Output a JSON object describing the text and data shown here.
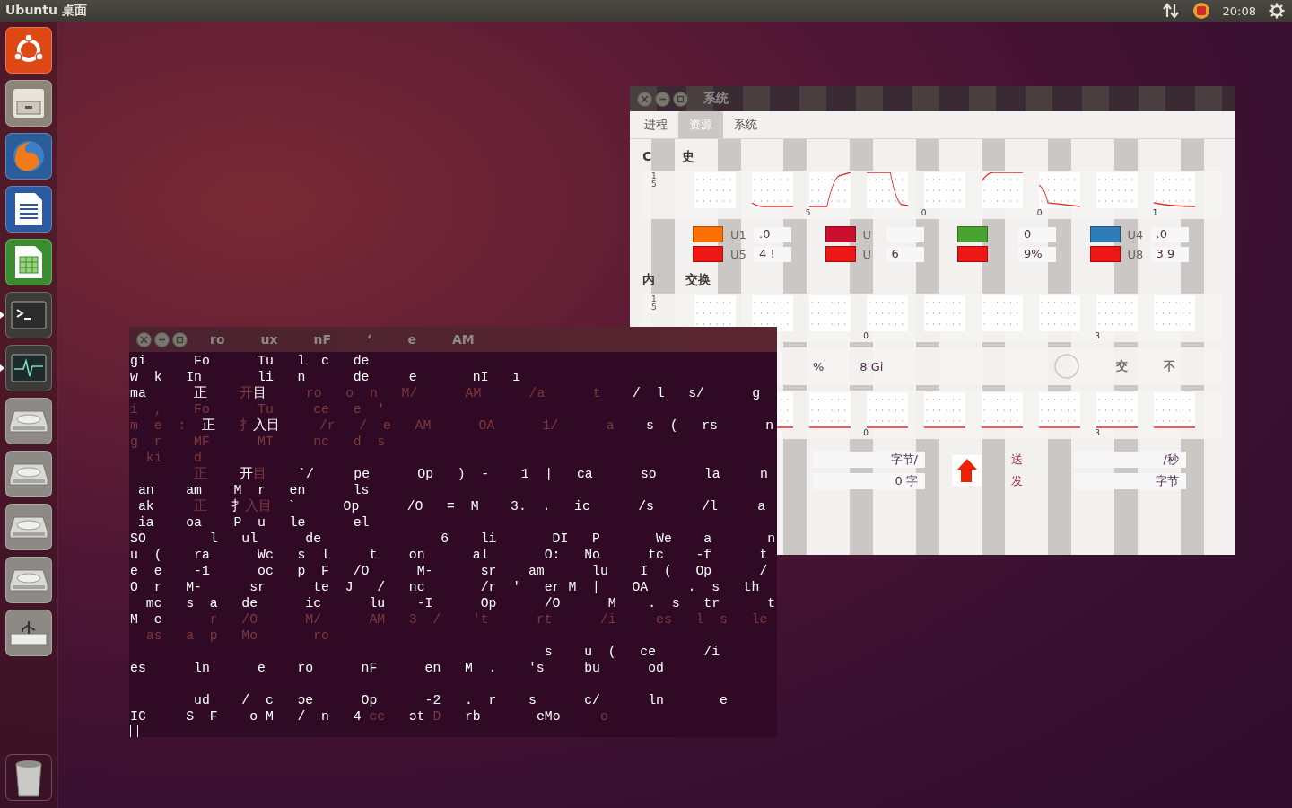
{
  "top_bar": {
    "title": "Ubuntu 桌面",
    "clock": "20:08"
  },
  "launcher": [
    {
      "kind": "ubuntu",
      "running": false
    },
    {
      "kind": "files",
      "running": false
    },
    {
      "kind": "firefox",
      "running": false
    },
    {
      "kind": "writer",
      "running": false
    },
    {
      "kind": "calc",
      "running": false
    },
    {
      "kind": "terminal",
      "running": true
    },
    {
      "kind": "monitor",
      "running": true
    },
    {
      "kind": "drive",
      "running": false
    },
    {
      "kind": "drive",
      "running": false
    },
    {
      "kind": "drive",
      "running": false
    },
    {
      "kind": "drive",
      "running": false
    },
    {
      "kind": "usb",
      "running": false
    },
    {
      "kind": "trash",
      "running": false
    }
  ],
  "system_monitor": {
    "title": "系统",
    "tabs": [
      {
        "label": "进程",
        "selected": false
      },
      {
        "label": "资源",
        "selected": true
      },
      {
        "label": "系统",
        "selected": false
      }
    ],
    "cpu": {
      "heading": [
        "C",
        "史"
      ],
      "y_labels": [
        "1",
        "5"
      ],
      "x_labels": [
        "5",
        "0",
        "0",
        "1"
      ],
      "legend": [
        {
          "color": "#ff7000",
          "label": "U1",
          "value": ".0"
        },
        {
          "color": "#c8102e",
          "label": "U"
        },
        {
          "color": "#4aa232",
          "value": "0"
        },
        {
          "color": "#2e7db8",
          "label": "U4",
          "value": ".0"
        },
        {
          "color": "#ee1515",
          "label": "U5",
          "value": "4 !"
        },
        {
          "color": "#ee1515",
          "label": "U",
          "value": "6"
        },
        {
          "color": "#ee1515",
          "value": "9%"
        },
        {
          "color": "#ee1515",
          "label": "U8",
          "value": "3 9"
        }
      ]
    },
    "memory": {
      "heading": [
        "内",
        "交换"
      ],
      "y_labels": [
        "1",
        "5"
      ],
      "x_labels": [
        "0",
        "3"
      ],
      "percent": "%",
      "amount": "8 Gi",
      "swap": [
        "交",
        "不"
      ]
    },
    "network": {
      "x_labels": [
        "0",
        "3"
      ],
      "receive": [
        "字节/",
        "0 字"
      ],
      "send_label": [
        "送",
        "发"
      ],
      "send": [
        "/秒",
        "字节"
      ]
    }
  },
  "terminal": {
    "title": [
      "ro",
      "ux",
      "nF",
      "ʻ",
      "e",
      "AM"
    ],
    "lines": [
      {
        "segments": [
          {
            "text": "gi      Fo      Tu   l  c   de",
            "dim": false
          }
        ]
      },
      {
        "segments": [
          {
            "text": "w  k   In       li   n      de     e       nI   ı",
            "dim": false
          }
        ]
      },
      {
        "segments": [
          {
            "text": "ma      正",
            "dim": false
          },
          {
            "text": "    开",
            "dim": true
          },
          {
            "text": "目",
            "dim": false
          },
          {
            "text": "     ro   o  n   M/      AM      /a      t",
            "dim": true
          },
          {
            "text": "    /  l   s/      g",
            "dim": false
          }
        ]
      },
      {
        "segments": [
          {
            "text": "i  ,    Fo      Tu     ce   e  '",
            "dim": true
          }
        ]
      },
      {
        "segments": [
          {
            "text": "m  e  :  ",
            "dim": true
          },
          {
            "text": "正",
            "dim": false
          },
          {
            "text": "   扌",
            "dim": true
          },
          {
            "text": "入目",
            "dim": false
          },
          {
            "text": "     /r   /  e   AM      OA      1/      a",
            "dim": true
          },
          {
            "text": "    s  (   rs      n",
            "dim": false
          }
        ]
      },
      {
        "segments": [
          {
            "text": "g  r    MF      MT     nc   d  s",
            "dim": true
          }
        ]
      },
      {
        "segments": [
          {
            "text": "  ki    d",
            "dim": true
          }
        ]
      },
      {
        "segments": [
          {
            "text": "        正",
            "dim": true
          },
          {
            "text": "    开",
            "dim": false
          },
          {
            "text": "目",
            "dim": true
          },
          {
            "text": "    `/     pe      Op   )  -    1  |   ca      so      la     n",
            "dim": false
          }
        ]
      },
      {
        "segments": [
          {
            "text": " an    am    M  r   en      ls",
            "dim": false
          }
        ]
      },
      {
        "segments": [
          {
            "text": " ak",
            "dim": false
          },
          {
            "text": "     正",
            "dim": true
          },
          {
            "text": "   扌",
            "dim": false
          },
          {
            "text": "入目",
            "dim": true
          },
          {
            "text": "  `      Op      /O   =  M    3.  .   ic      /s      /l     a",
            "dim": false
          }
        ]
      },
      {
        "segments": [
          {
            "text": " ia    oa    P  u   le      el",
            "dim": false
          }
        ]
      },
      {
        "segments": [
          {
            "text": "SO        l   ul      de               6    li       DI   P       We    a       n",
            "dim": false
          }
        ]
      },
      {
        "segments": [
          {
            "text": "u  (    ra      Wc   s  l     t    on      al       O:   No      tc    -f      t",
            "dim": false
          }
        ]
      },
      {
        "segments": [
          {
            "text": "e  e    -1      oc   p  F   /O      M-      sr    am      lu    I  (   Op      /",
            "dim": false
          }
        ]
      },
      {
        "segments": [
          {
            "text": "O  r   M-      sr      te  J   /   nc       /r  '   er M  |    OA     .  s   th",
            "dim": false
          }
        ]
      },
      {
        "segments": [
          {
            "text": "  mc   s  a   de      ic      lu    -I      Op      /O      M    .  s   tr      t",
            "dim": false
          }
        ]
      },
      {
        "segments": [
          {
            "text": "M  e",
            "dim": false
          },
          {
            "text": "      r   /O      M/      AM   3  /    't      rt      /i     es   l  s   le",
            "dim": true
          }
        ]
      },
      {
        "segments": [
          {
            "text": "  as   a  p   Mo       ro",
            "dim": true
          }
        ]
      },
      {
        "segments": [
          {
            "text": "                                                    s    u  (   ce      /i",
            "dim": false
          }
        ]
      },
      {
        "segments": [
          {
            "text": "es      ln      e    ro      nF      en   M  .    's     bu      od",
            "dim": false
          }
        ],
        "blank_after": true
      },
      {
        "segments": [
          {
            "text": "        ud    /  c   ɔe      Op      -2   .  r    s      c/      ln       e",
            "dim": false
          }
        ]
      },
      {
        "segments": [
          {
            "text": "IC     S  F    o M   /  n   4 ",
            "dim": false
          },
          {
            "text": "cc",
            "dim": true
          },
          {
            "text": "   ɔt ",
            "dim": false
          },
          {
            "text": "D",
            "dim": true
          },
          {
            "text": "   rb       eMo",
            "dim": false
          },
          {
            "text": "     o",
            "dim": true
          }
        ]
      }
    ]
  }
}
